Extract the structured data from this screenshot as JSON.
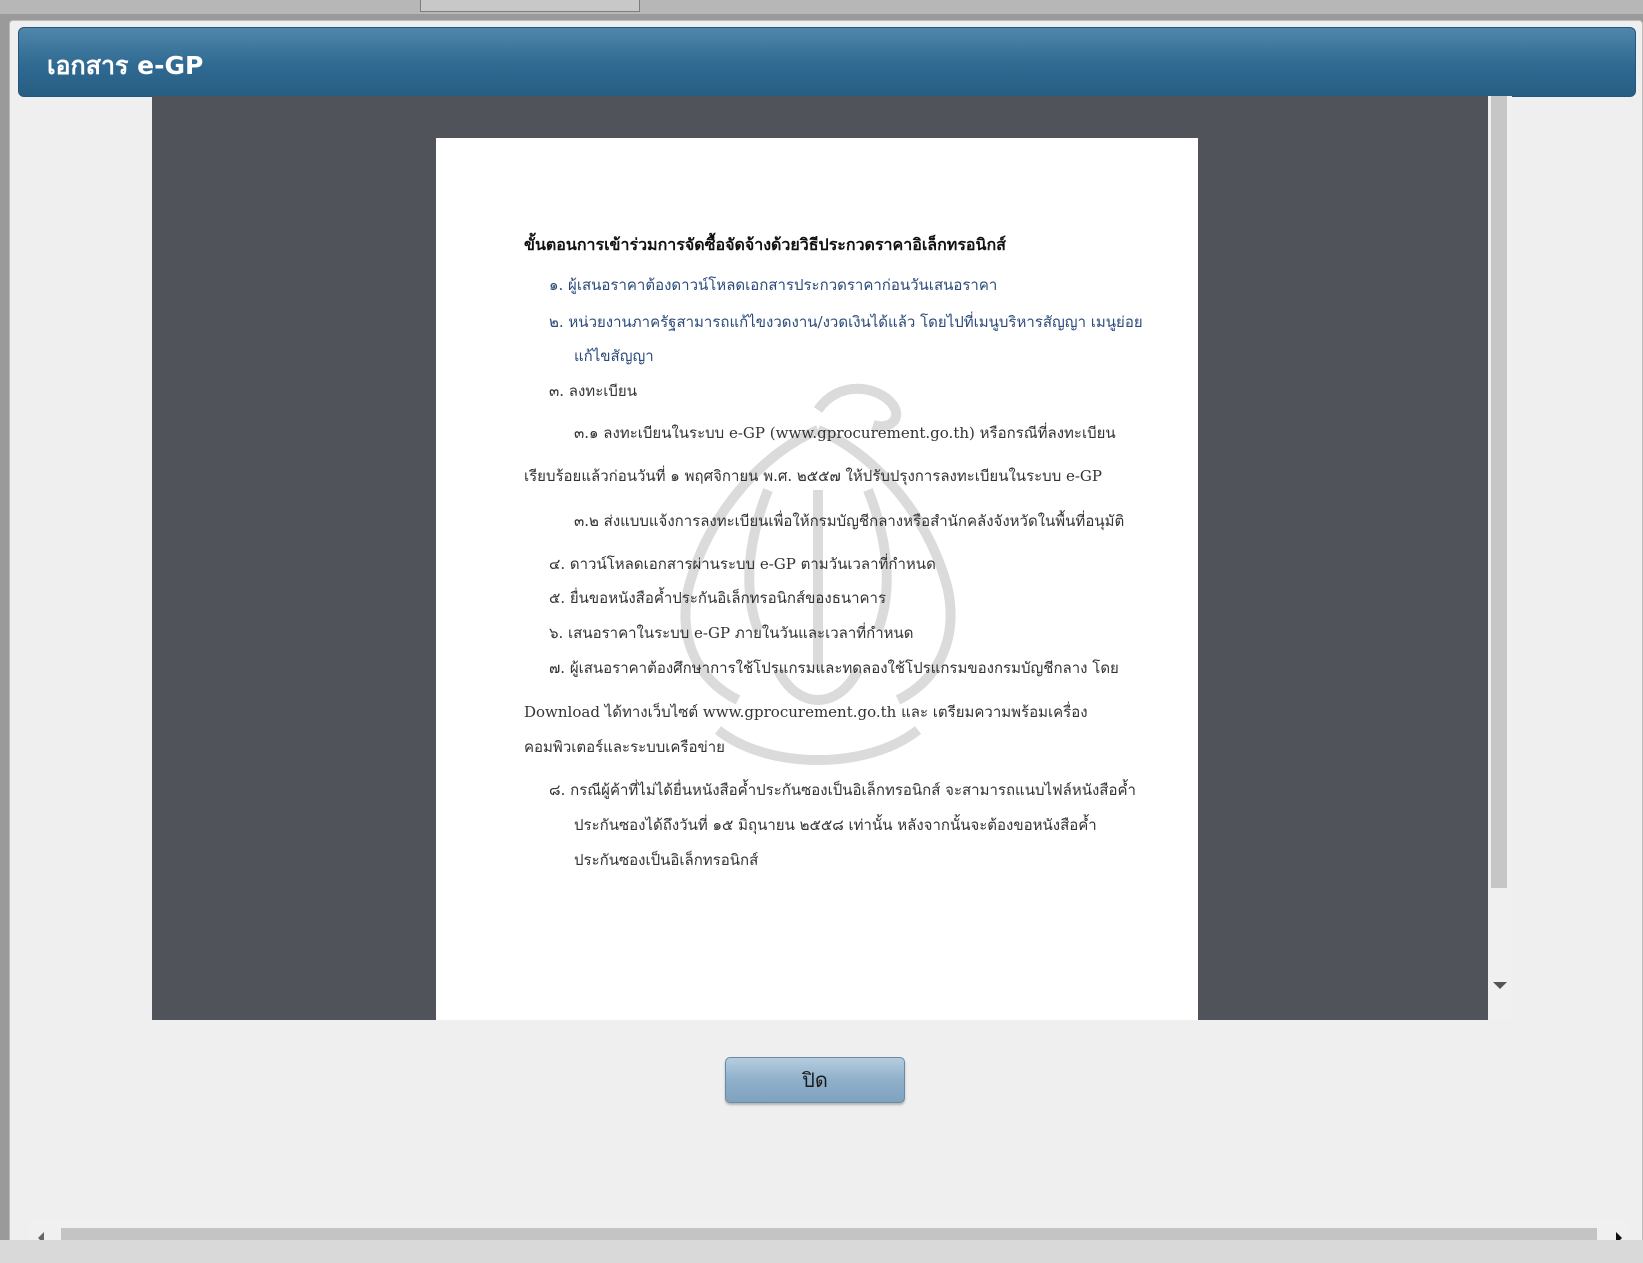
{
  "dialog": {
    "title": "เอกสาร e-GP",
    "close_label": "ปิด"
  },
  "document": {
    "heading": "ขั้นตอนการเข้าร่วมการจัดซื้อจัดจ้างด้วยวิธีประกวดราคาอิเล็กทรอนิกส์",
    "lines": [
      "๑. ผู้เสนอราคาต้องดาวน์โหลดเอกสารประกวดราคาก่อนวันเสนอราคา",
      "๒. หน่วยงานภาครัฐสามารถแก้ไขงวดงาน/งวดเงินได้แล้ว โดยไปที่เมนูบริหารสัญญา เมนูย่อย",
      "แก้ไขสัญญา",
      "๓. ลงทะเบียน",
      "๓.๑ ลงทะเบียนในระบบ e-GP (www.gprocurement.go.th) หรือกรณีที่ลงทะเบียน",
      "เรียบร้อยแล้วก่อนวันที่ ๑ พฤศจิกายน พ.ศ. ๒๕๕๗ ให้ปรับปรุงการลงทะเบียนในระบบ e-GP",
      "๓.๒ ส่งแบบแจ้งการลงทะเบียนเพื่อให้กรมบัญชีกลางหรือสำนักคลังจังหวัดในพื้นที่อนุมัติ",
      "๔. ดาวน์โหลดเอกสารผ่านระบบ e-GP ตามวันเวลาที่กำหนด",
      "๕. ยื่นขอหนังสือค้ำประกันอิเล็กทรอนิกส์ของธนาคาร",
      "๖. เสนอราคาในระบบ e-GP ภายในวันและเวลาที่กำหนด",
      "๗. ผู้เสนอราคาต้องศึกษาการใช้โปรแกรมและทดลองใช้โปรแกรมของกรมบัญชีกลาง โดย",
      "Download ได้ทางเว็บไซต์ www.gprocurement.go.th และ เตรียมความพร้อมเครื่อง",
      "คอมพิวเตอร์และระบบเครือข่าย",
      "๘. กรณีผู้ค้าที่ไม่ได้ยื่นหนังสือค้ำประกันซองเป็นอิเล็กทรอนิกส์ จะสามารถแนบไฟล์หนังสือค้ำ",
      "ประกันซองได้ถึงวันที่ ๑๕ มิถุนายน ๒๕๕๘ เท่านั้น หลังจากนั้นจะต้องขอหนังสือค้ำ",
      "ประกันซองเป็นอิเล็กทรอนิกส์"
    ]
  },
  "colors": {
    "titlebar": "#2f6a92",
    "viewer_bg": "#50545a",
    "button": "#8fb0ca"
  }
}
